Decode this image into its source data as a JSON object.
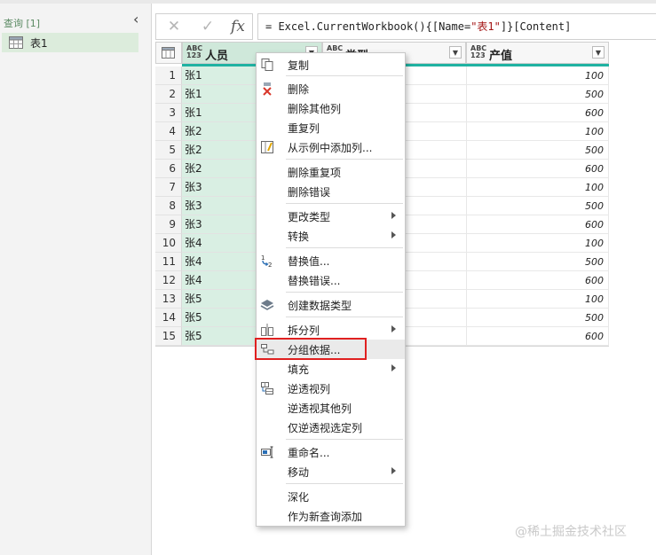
{
  "queries": {
    "header": "查询 [1]",
    "items": [
      {
        "label": "表1",
        "icon": "table-icon"
      }
    ]
  },
  "formula": {
    "prefix": "= Excel.CurrentWorkbook(){[Name=",
    "string": "\"表1\"",
    "suffix": "]}[Content]",
    "fx_label": "fx",
    "cancel_icon": "✕",
    "confirm_icon": "✓"
  },
  "columns": [
    {
      "type_icon": "ABC\n123",
      "name": "人员"
    },
    {
      "type_icon": "ABC\n123",
      "name": "类型"
    },
    {
      "type_icon": "ABC\n123",
      "name": "产值"
    }
  ],
  "rows": [
    {
      "n": "1",
      "person": "张1",
      "value": "100"
    },
    {
      "n": "2",
      "person": "张1",
      "value": "500"
    },
    {
      "n": "3",
      "person": "张1",
      "value": "600"
    },
    {
      "n": "4",
      "person": "张2",
      "value": "100"
    },
    {
      "n": "5",
      "person": "张2",
      "value": "500"
    },
    {
      "n": "6",
      "person": "张2",
      "value": "600"
    },
    {
      "n": "7",
      "person": "张3",
      "value": "100"
    },
    {
      "n": "8",
      "person": "张3",
      "value": "500"
    },
    {
      "n": "9",
      "person": "张3",
      "value": "600"
    },
    {
      "n": "10",
      "person": "张4",
      "value": "100"
    },
    {
      "n": "11",
      "person": "张4",
      "value": "500"
    },
    {
      "n": "12",
      "person": "张4",
      "value": "600"
    },
    {
      "n": "13",
      "person": "张5",
      "value": "100"
    },
    {
      "n": "14",
      "person": "张5",
      "value": "500"
    },
    {
      "n": "15",
      "person": "张5",
      "value": "600"
    }
  ],
  "menu": {
    "copy": "复制",
    "remove": "删除",
    "remove_other": "删除其他列",
    "duplicate": "重复列",
    "add_from_examples": "从示例中添加列...",
    "remove_duplicates": "删除重复项",
    "remove_errors": "删除错误",
    "change_type": "更改类型",
    "transform": "转换",
    "replace_values": "替换值...",
    "replace_errors": "替换错误...",
    "create_data_type": "创建数据类型",
    "split_column": "拆分列",
    "group_by": "分组依据...",
    "fill": "填充",
    "unpivot": "逆透视列",
    "unpivot_other": "逆透视其他列",
    "unpivot_selected": "仅逆透视选定列",
    "rename": "重命名...",
    "move": "移动",
    "drill_down": "深化",
    "add_as_new_query": "作为新查询添加"
  },
  "watermark": "@稀土掘金技术社区",
  "colors": {
    "accent": "#20b2a2",
    "selected_column": "#d9efe3",
    "highlight_box": "#e02020"
  }
}
